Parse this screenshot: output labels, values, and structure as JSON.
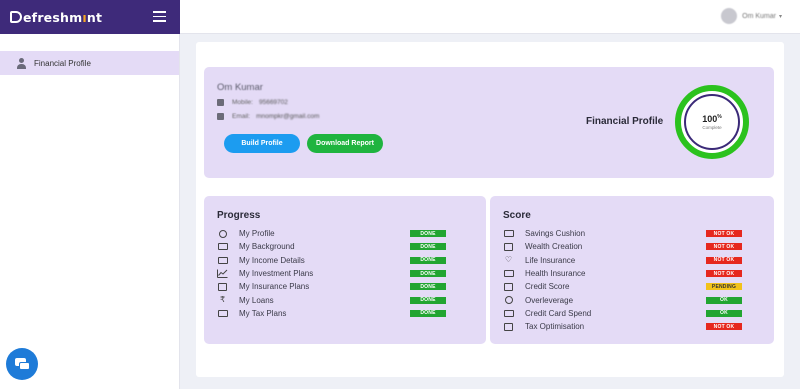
{
  "brand": {
    "prefix": "R",
    "name_part1": "efresh",
    "name_part2": "m",
    "accent": "ı",
    "name_part3": "nt"
  },
  "header": {
    "user_name": "Om Kumar",
    "caret": "▾"
  },
  "sidebar": {
    "items": [
      {
        "label": "Financial Profile",
        "icon": "person-icon"
      }
    ]
  },
  "profile": {
    "name": "Om Kumar",
    "mobile_label": "Mobile:",
    "mobile_value": "95669702",
    "email_label": "Email:",
    "email_value": "mnompkr@gmail.com",
    "build_button": "Build Profile",
    "download_button": "Download Report",
    "section_label": "Financial Profile",
    "completion_value": "100",
    "completion_percent_sign": "%",
    "completion_sub": "Complete",
    "completion_fraction": 1.0
  },
  "progress": {
    "title": "Progress",
    "items": [
      {
        "label": "My Profile",
        "status": "DONE",
        "icon": "user-circle-icon"
      },
      {
        "label": "My Background",
        "status": "DONE",
        "icon": "id-card-icon"
      },
      {
        "label": "My Income Details",
        "status": "DONE",
        "icon": "money-bill-icon"
      },
      {
        "label": "My Investment Plans",
        "status": "DONE",
        "icon": "chart-line-icon"
      },
      {
        "label": "My Insurance Plans",
        "status": "DONE",
        "icon": "medical-bag-icon"
      },
      {
        "label": "My Loans",
        "status": "DONE",
        "icon": "rupee-icon"
      },
      {
        "label": "My Tax Plans",
        "status": "DONE",
        "icon": "money-bill-wave-icon"
      }
    ]
  },
  "score": {
    "title": "Score",
    "items": [
      {
        "label": "Savings Cushion",
        "status": "NOT OK",
        "icon": "wallet-icon"
      },
      {
        "label": "Wealth Creation",
        "status": "NOT OK",
        "icon": "growth-icon"
      },
      {
        "label": "Life Insurance",
        "status": "NOT OK",
        "icon": "heart-hand-icon"
      },
      {
        "label": "Health Insurance",
        "status": "NOT OK",
        "icon": "health-icon"
      },
      {
        "label": "Credit Score",
        "status": "PENDING",
        "icon": "credit-score-icon"
      },
      {
        "label": "Overleverage",
        "status": "OK",
        "icon": "leverage-icon"
      },
      {
        "label": "Credit Card Spend",
        "status": "OK",
        "icon": "credit-card-icon"
      },
      {
        "label": "Tax Optimisation",
        "status": "NOT OK",
        "icon": "tax-icon"
      }
    ]
  },
  "colors": {
    "brand_bar": "#3e2a7a",
    "card_bg": "#e4dbf6",
    "done": "#22a531",
    "not_ok": "#e6281e",
    "pending": "#f2c21a",
    "ring": "#2bc21e",
    "build_button": "#1c9cf0",
    "download_button": "#1fb43f"
  }
}
